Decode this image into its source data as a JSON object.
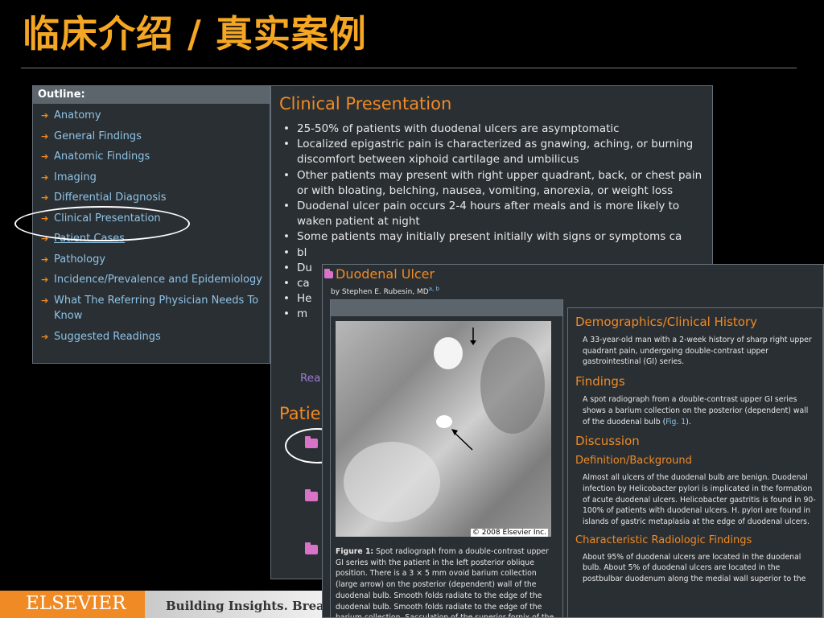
{
  "slide": {
    "title": "临床介绍 / 真实案例"
  },
  "outline": {
    "heading": "Outline:",
    "items": [
      "Anatomy",
      "General Findings",
      "Anatomic Findings",
      "Imaging",
      "Differential Diagnosis",
      "Clinical Presentation",
      "Patient Cases",
      "Pathology",
      "Incidence/Prevalence and Epidemiology",
      "What The Referring Physician Needs To Know",
      "Suggested Readings"
    ]
  },
  "content": {
    "heading": "Clinical Presentation",
    "bullets": [
      "25-50% of patients with duodenal ulcers are asymptomatic",
      "Localized epigastric pain is characterized as gnawing, aching, or burning discomfort between xiphoid cartilage and umbilicus",
      "Other patients may present with right upper quadrant, back, or chest pain or with bloating, belching, nausea, vomiting, anorexia, or weight loss",
      "Duodenal ulcer pain occurs 2-4 hours after meals and is more likely to waken patient at night",
      "Some patients may initially present initially with signs or symptoms ca",
      "bl",
      "Du",
      "ca",
      "He",
      "m"
    ],
    "read_more": "Rea",
    "patient_cases_heading": "Patie"
  },
  "case": {
    "title": "Duodenal Ulcer",
    "byline": "by Stephen E. Rubesin, MD",
    "byline_sup": "a, b",
    "copyright": "© 2008 Elsevier Inc.",
    "figure_label": "Figure 1:",
    "figure_caption": " Spot radiograph from a double-contrast upper GI series with the patient in the left posterior oblique position. There is a 3 × 5 mm ovoid barium collection (large arrow) on the posterior (dependent) wall of the duodenal bulb. Smooth folds radiate to the edge of the duodenal bulb. Smooth folds radiate to the edge of the barium collection. Sacculation of the superior fornix of the duodenal bulb (small arrow) changed size and shape with",
    "sections": {
      "demographics_heading": "Demographics/Clinical History",
      "demographics_text": "A 33-year-old man with a 2-week history of sharp right upper quadrant pain, undergoing double-contrast upper gastrointestinal (GI) series.",
      "findings_heading": "Findings",
      "findings_text": "A spot radiograph from a double-contrast upper GI series shows a barium collection on the posterior (dependent) wall of the duodenal bulb (",
      "findings_link": "Fig. 1",
      "findings_end": ").",
      "discussion_heading": "Discussion",
      "definition_heading": "Definition/Background",
      "definition_text": "Almost all ulcers of the duodenal bulb are benign. Duodenal infection by Helicobacter pylori is implicated in the formation of acute duodenal ulcers. Helicobacter gastritis is found in 90-100% of patients with duodenal ulcers. H. pylori are found in islands of gastric metaplasia at the edge of duodenal ulcers.",
      "radiologic_heading": "Characteristic Radiologic Findings",
      "radiologic_text": "About 95% of duodenal ulcers are located in the duodenal bulb. About 5% of duodenal ulcers are located in the postbulbar duodenum along the medial wall superior to the"
    }
  },
  "footer": {
    "brand": "ELSEVIER",
    "tagline": "Building Insights. Breaking E"
  },
  "colors": {
    "accent_orange": "#f08a24",
    "title_orange": "#f5a623",
    "link_blue": "#8fc3e6",
    "panel_bg": "#2a2f33"
  }
}
